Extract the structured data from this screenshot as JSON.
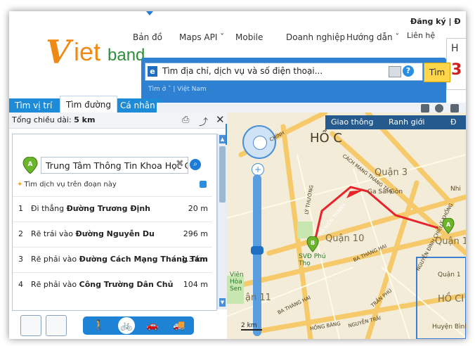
{
  "logo": {
    "brand_v": "V",
    "brand_iet": "iet",
    "brand_band": "band"
  },
  "topnav": {
    "items": [
      "Bản đồ",
      "Maps API ˇ",
      "Mobile",
      "Doanh nghiệp",
      "Hướng dẫn ˇ"
    ],
    "register": "Đăng ký | Đ",
    "contact": "Liên hệ"
  },
  "hotline": {
    "label": "H",
    "number": "3"
  },
  "search": {
    "placeholder": "Tìm địa chỉ, dịch vụ và số điện thoại...",
    "button": "Tìm",
    "scope": "Tìm ở  ˇ  |  Việt Nam"
  },
  "tabs": [
    "Tìm vị trí",
    "Tìm đường",
    "Cá nhân"
  ],
  "panel": {
    "total_label": "Tổng chiều dài:",
    "total_value": "5 km",
    "address": "Trung Tâm Thông Tin Khoa Học Côn",
    "service_link": "Tìm dịch vụ trên đoạn này",
    "steps": [
      {
        "no": "1",
        "prefix": "Đi thẳng ",
        "street": "Đường Trương Định",
        "dist": "20 m"
      },
      {
        "no": "2",
        "prefix": "Rẽ trái vào ",
        "street": "Đường Nguyễn Du",
        "dist": "296 m"
      },
      {
        "no": "3",
        "prefix": "Rẽ phải vào ",
        "street": "Đường Cách Mạng Tháng Tám",
        "dist": "1.3 km"
      },
      {
        "no": "4",
        "prefix": "Rẽ phải vào ",
        "street": "Công Trường Dân Chủ",
        "dist": "104 m"
      }
    ]
  },
  "map": {
    "toolbar": [
      "Giao thông",
      "Ranh giới",
      "Đ"
    ],
    "labels": {
      "ho_chi": "HỒ C",
      "quan3": "Quận 3",
      "quan10": "Quận 10",
      "quan1": "Quận 1",
      "sai_gon": "Ga Sài Gòn",
      "phu_tho": "SVĐ Phú Thọ",
      "hoa_sen": "Viên Hòa Sen",
      "quan11": "ận 11",
      "nhi": "Nhi",
      "huyen_binh": "Huyện Bình",
      "ho_chi2": "HỒ CI",
      "quan1b": "Quận 1"
    },
    "roads": {
      "cmtt": "CÁCH MẠNG THÁNG TÁM",
      "tohien": "TÔ HIẾN THÀNH",
      "bathang1": "BA THÁNG HAI",
      "bathang2": "BA THÁNG HAI",
      "nguyenchi": "NGUYỄN ĐÌNH CHIỂU",
      "tranphu": "TRẦN PHÚ",
      "hongbang": "HỒNG BÀNG",
      "nguyentrai": "NGUYỄN TRÃI",
      "lythuong": "LÝ THƯỜNG",
      "chinh": "CHÍNH",
      "vkhong": "Y KHỔNG"
    },
    "scale": "2 km",
    "marker_a": "A",
    "marker_b": "B",
    "route_color": "#e8242a"
  }
}
